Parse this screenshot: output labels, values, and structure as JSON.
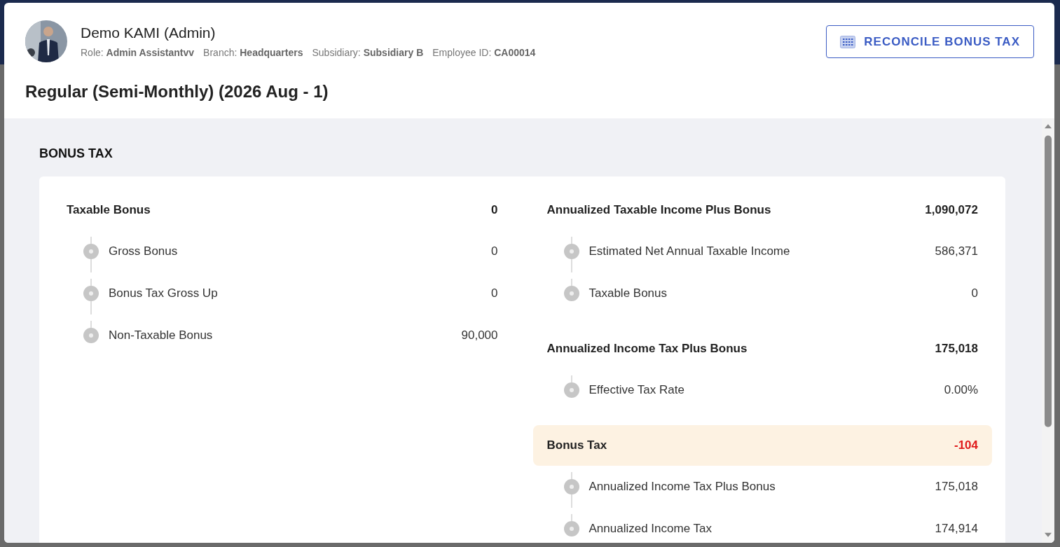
{
  "employee": {
    "name": "Demo KAMI (Admin)",
    "details": [
      {
        "label": "Role:",
        "value": "Admin Assistantvv"
      },
      {
        "label": "Branch:",
        "value": "Headquarters"
      },
      {
        "label": "Subsidiary:",
        "value": "Subsidiary B"
      },
      {
        "label": "Employee ID:",
        "value": "CA00014"
      }
    ]
  },
  "action_button": {
    "label": "RECONCILE BONUS TAX"
  },
  "payroll_title": "Regular (Semi-Monthly) (2026 Aug - 1)",
  "section_title": "BONUS TAX",
  "columns": [
    [
      {
        "label": "Taxable Bonus",
        "value": "0",
        "highlighted": false,
        "negative": false,
        "children": [
          {
            "label": "Gross Bonus",
            "value": "0"
          },
          {
            "label": "Bonus Tax Gross Up",
            "value": "0"
          },
          {
            "label": "Non-Taxable Bonus",
            "value": "90,000"
          }
        ]
      }
    ],
    [
      {
        "label": "Annualized Taxable Income Plus Bonus",
        "value": "1,090,072",
        "highlighted": false,
        "negative": false,
        "children": [
          {
            "label": "Estimated Net Annual Taxable Income",
            "value": "586,371"
          },
          {
            "label": "Taxable Bonus",
            "value": "0"
          }
        ]
      },
      {
        "label": "Annualized Income Tax Plus Bonus",
        "value": "175,018",
        "highlighted": false,
        "negative": false,
        "children": [
          {
            "label": "Effective Tax Rate",
            "value": "0.00%"
          }
        ]
      },
      {
        "label": "Bonus Tax",
        "value": "-104",
        "highlighted": true,
        "negative": true,
        "children": [
          {
            "label": "Annualized Income Tax Plus Bonus",
            "value": "175,018"
          },
          {
            "label": "Annualized Income Tax",
            "value": "174,914"
          }
        ]
      }
    ]
  ]
}
